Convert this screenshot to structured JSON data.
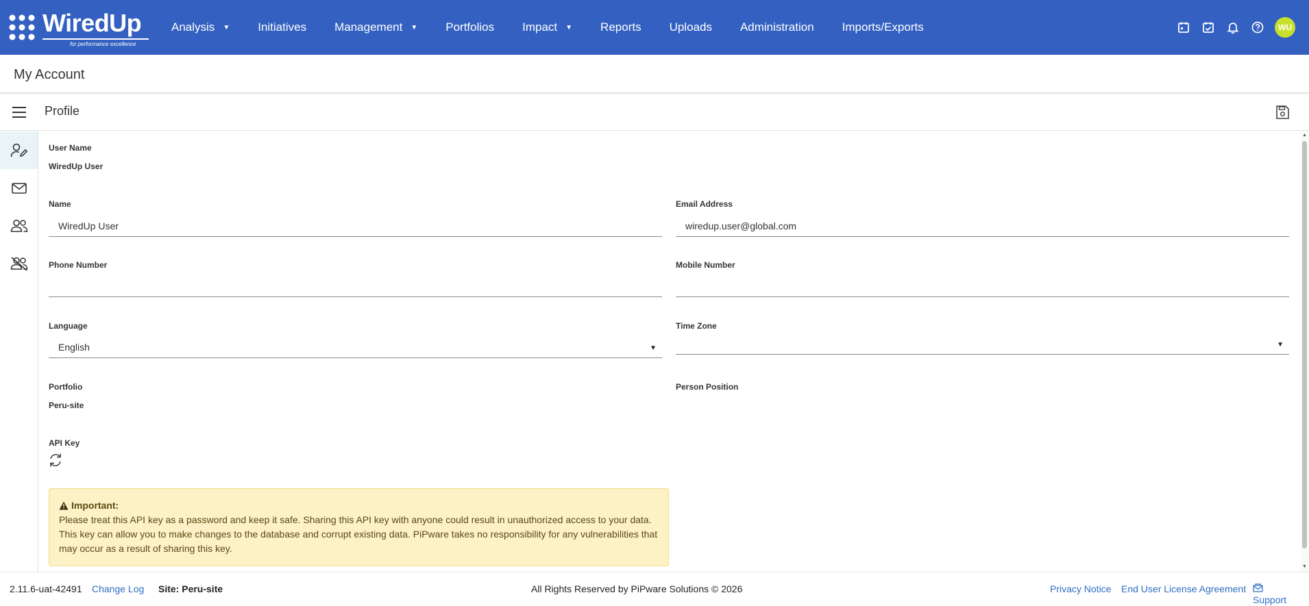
{
  "brand": {
    "name": "WiredUp",
    "tagline": "for performance excellence"
  },
  "nav": {
    "items": [
      {
        "label": "Analysis",
        "dropdown": true
      },
      {
        "label": "Initiatives",
        "dropdown": false
      },
      {
        "label": "Management",
        "dropdown": true
      },
      {
        "label": "Portfolios",
        "dropdown": false
      },
      {
        "label": "Impact",
        "dropdown": true
      },
      {
        "label": "Reports",
        "dropdown": false
      },
      {
        "label": "Uploads",
        "dropdown": false
      },
      {
        "label": "Administration",
        "dropdown": false
      },
      {
        "label": "Imports/Exports",
        "dropdown": false
      }
    ],
    "icons": [
      "calendar-icon",
      "calendar-check-icon",
      "bell-icon",
      "help-icon"
    ],
    "avatar_initials": "WU"
  },
  "page": {
    "title": "My Account",
    "section_title": "Profile"
  },
  "side_tabs": [
    "user-edit-icon",
    "mail-icon",
    "users-icon",
    "users-slash-icon"
  ],
  "profile": {
    "username_label": "User Name",
    "username_value": "WiredUp User",
    "name_label": "Name",
    "name_value": "WiredUp User",
    "email_label": "Email Address",
    "email_value": "wiredup.user@global.com",
    "phone_label": "Phone Number",
    "phone_value": "",
    "mobile_label": "Mobile Number",
    "mobile_value": "",
    "language_label": "Language",
    "language_value": "English",
    "timezone_label": "Time Zone",
    "timezone_value": "",
    "portfolio_label": "Portfolio",
    "portfolio_value": "Peru-site",
    "position_label": "Person Position",
    "position_value": "",
    "apikey_label": "API Key"
  },
  "warning": {
    "title": "Important:",
    "text": "Please treat this API key as a password and keep it safe. Sharing this API key with anyone could result in unauthorized access to your data. This key can allow you to make changes to the database and corrupt existing data. PiPware takes no responsibility for any vulnerabilities that may occur as a result of sharing this key."
  },
  "footer": {
    "version": "2.11.6-uat-42491",
    "changelog": "Change Log",
    "site": "Site: Peru-site",
    "copyright": "All Rights Reserved by PiPware Solutions © 2026",
    "privacy": "Privacy Notice",
    "eula": "End User License Agreement",
    "support": "Support"
  },
  "colors": {
    "nav_bg": "#3461c1",
    "avatar": "#c6e02b",
    "link": "#2f6fc4",
    "warning_bg": "#fdf1c6"
  }
}
